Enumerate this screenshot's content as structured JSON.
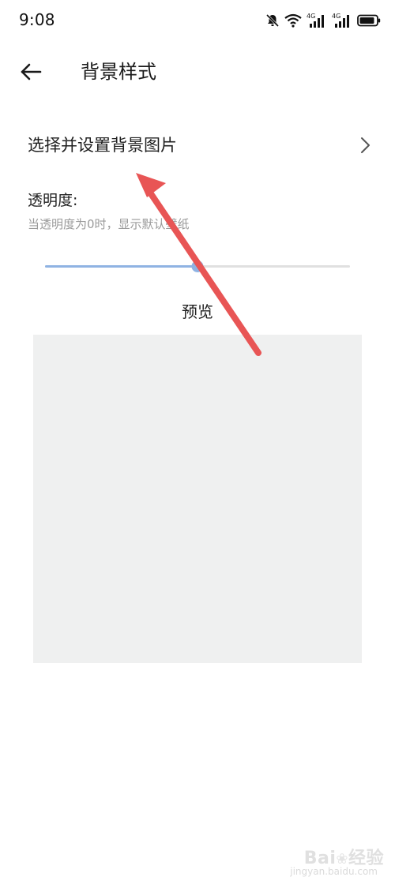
{
  "status_bar": {
    "time": "9:08",
    "icons": [
      "bell-muted-icon",
      "wifi-icon",
      "signal-4g-icon",
      "signal-4g-icon",
      "battery-icon"
    ],
    "network_label": "4G",
    "network_label_2": "4G"
  },
  "header": {
    "back_icon": "arrow-left-icon",
    "title": "背景样式"
  },
  "select_background": {
    "label": "选择并设置背景图片",
    "icon": "chevron-right-icon"
  },
  "opacity": {
    "label": "透明度:",
    "hint": "当透明度为0时，显示默认壁纸",
    "value_fraction": 0.5
  },
  "preview": {
    "label": "预览"
  },
  "colors": {
    "accent": "#8fb3e3",
    "track": "#e0e0e0",
    "preview_bg": "#eff0f0",
    "annotation": "#e85555"
  },
  "watermark": {
    "brand": "Bai",
    "brand_suffix": "经验",
    "sub": "jingyan.baidu.com"
  }
}
